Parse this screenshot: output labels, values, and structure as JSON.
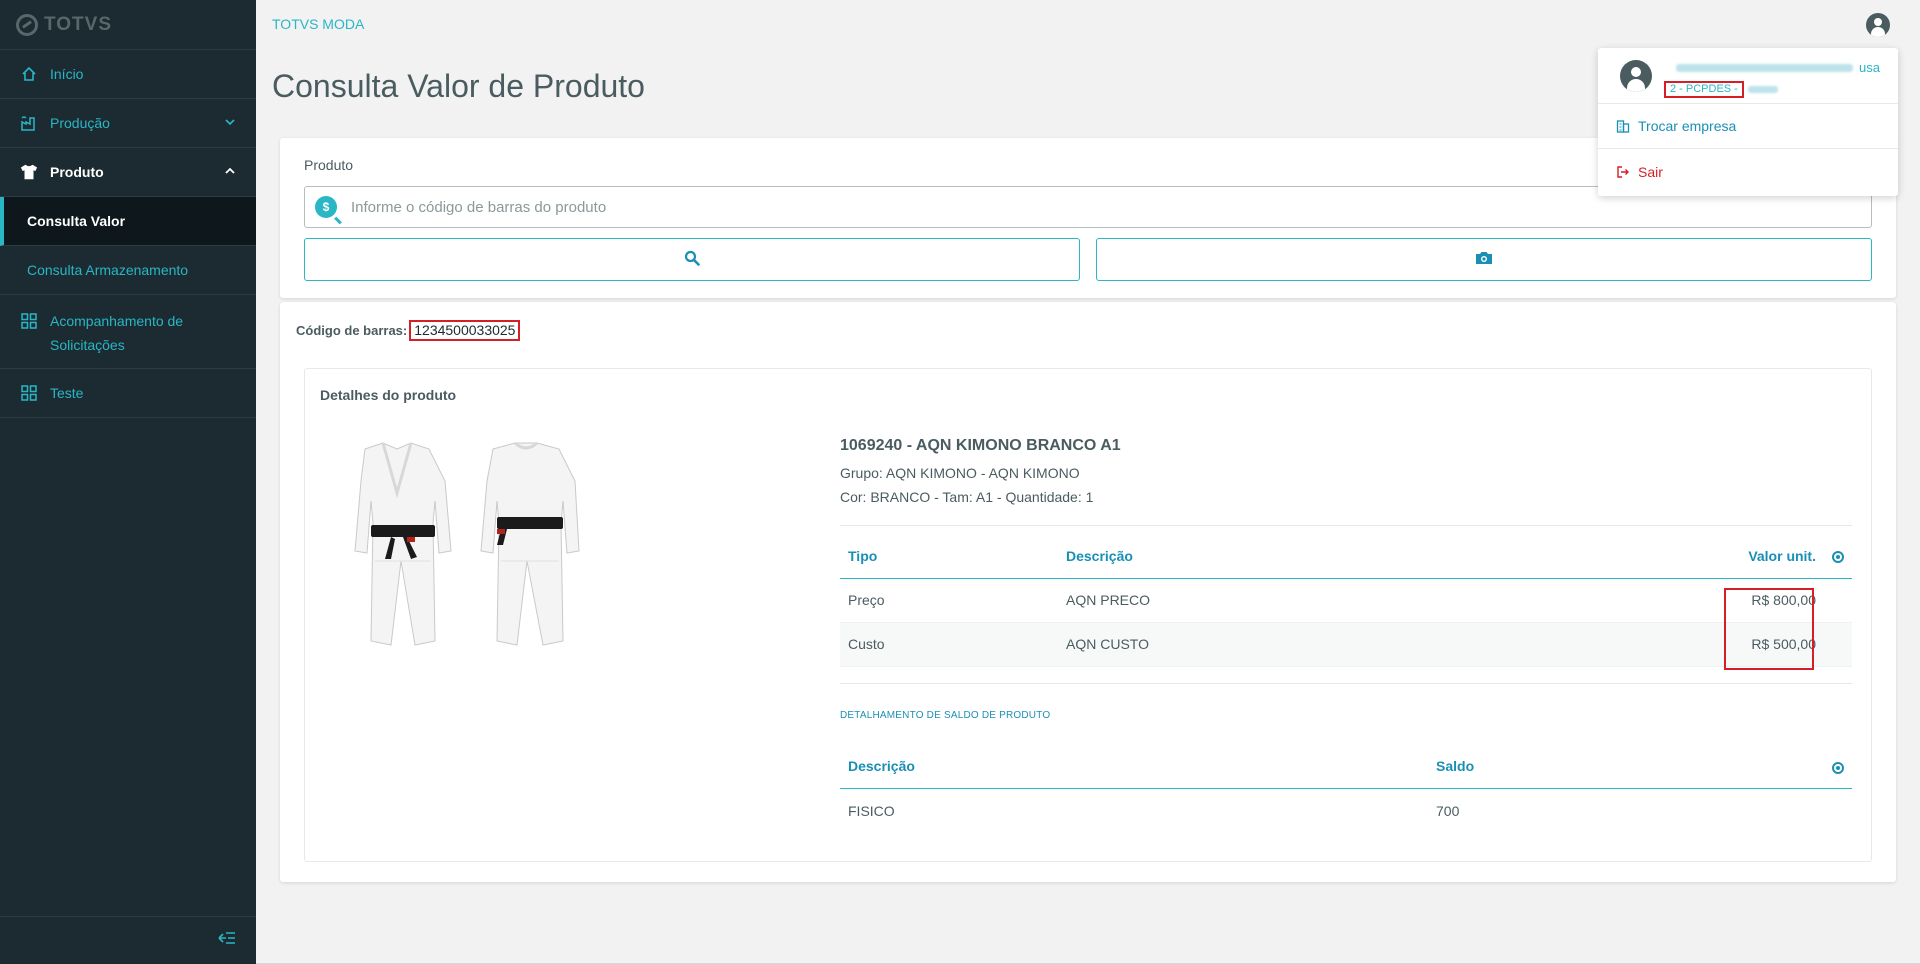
{
  "sidebar": {
    "logo": "TOTVS",
    "items": [
      {
        "label": "Início",
        "icon": "home-icon"
      },
      {
        "label": "Produção",
        "icon": "factory-icon"
      },
      {
        "label": "Produto",
        "icon": "shirt-icon"
      },
      {
        "label": "Acompanhamento de Solicitações",
        "icon": "grid-icon"
      },
      {
        "label": "Teste",
        "icon": "grid-icon"
      }
    ],
    "subitems": [
      {
        "label": "Consulta Valor"
      },
      {
        "label": "Consulta Armazenamento"
      }
    ]
  },
  "header": {
    "app_name": "TOTVS MODA"
  },
  "page": {
    "title": "Consulta Valor de Produto"
  },
  "search": {
    "label": "Produto",
    "placeholder": "Informe o código de barras do produto",
    "value": ""
  },
  "result": {
    "barcode_label": "Código de barras:",
    "barcode_value": "1234500033025",
    "details_title": "Detalhes do produto",
    "product_name": "1069240 - AQN KIMONO BRANCO A1",
    "group": "Grupo: AQN KIMONO - AQN KIMONO",
    "attrs": "Cor: BRANCO - Tam: A1 - Quantidade: 1",
    "price_table": {
      "headers": [
        "Tipo",
        "Descrição",
        "Valor unit."
      ],
      "rows": [
        [
          "Preço",
          "AQN PRECO",
          "R$ 800,00"
        ],
        [
          "Custo",
          "AQN CUSTO",
          "R$ 500,00"
        ]
      ]
    },
    "balance_link": "DETALHAMENTO DE SALDO DE PRODUTO",
    "balance_table": {
      "headers": [
        "Descrição",
        "Saldo"
      ],
      "rows": [
        [
          "FISICO",
          "700"
        ]
      ]
    }
  },
  "user_menu": {
    "name_suffix": "usa",
    "company": "2 - PCPDES -",
    "items": [
      {
        "label": "Trocar empresa",
        "icon": "building-icon"
      },
      {
        "label": "Sair",
        "icon": "logout-icon"
      }
    ]
  },
  "colors": {
    "primary": "#29b6c5",
    "sidebar_bg": "#1c2b31",
    "danger": "#d41f27",
    "text": "#4a5c60"
  }
}
